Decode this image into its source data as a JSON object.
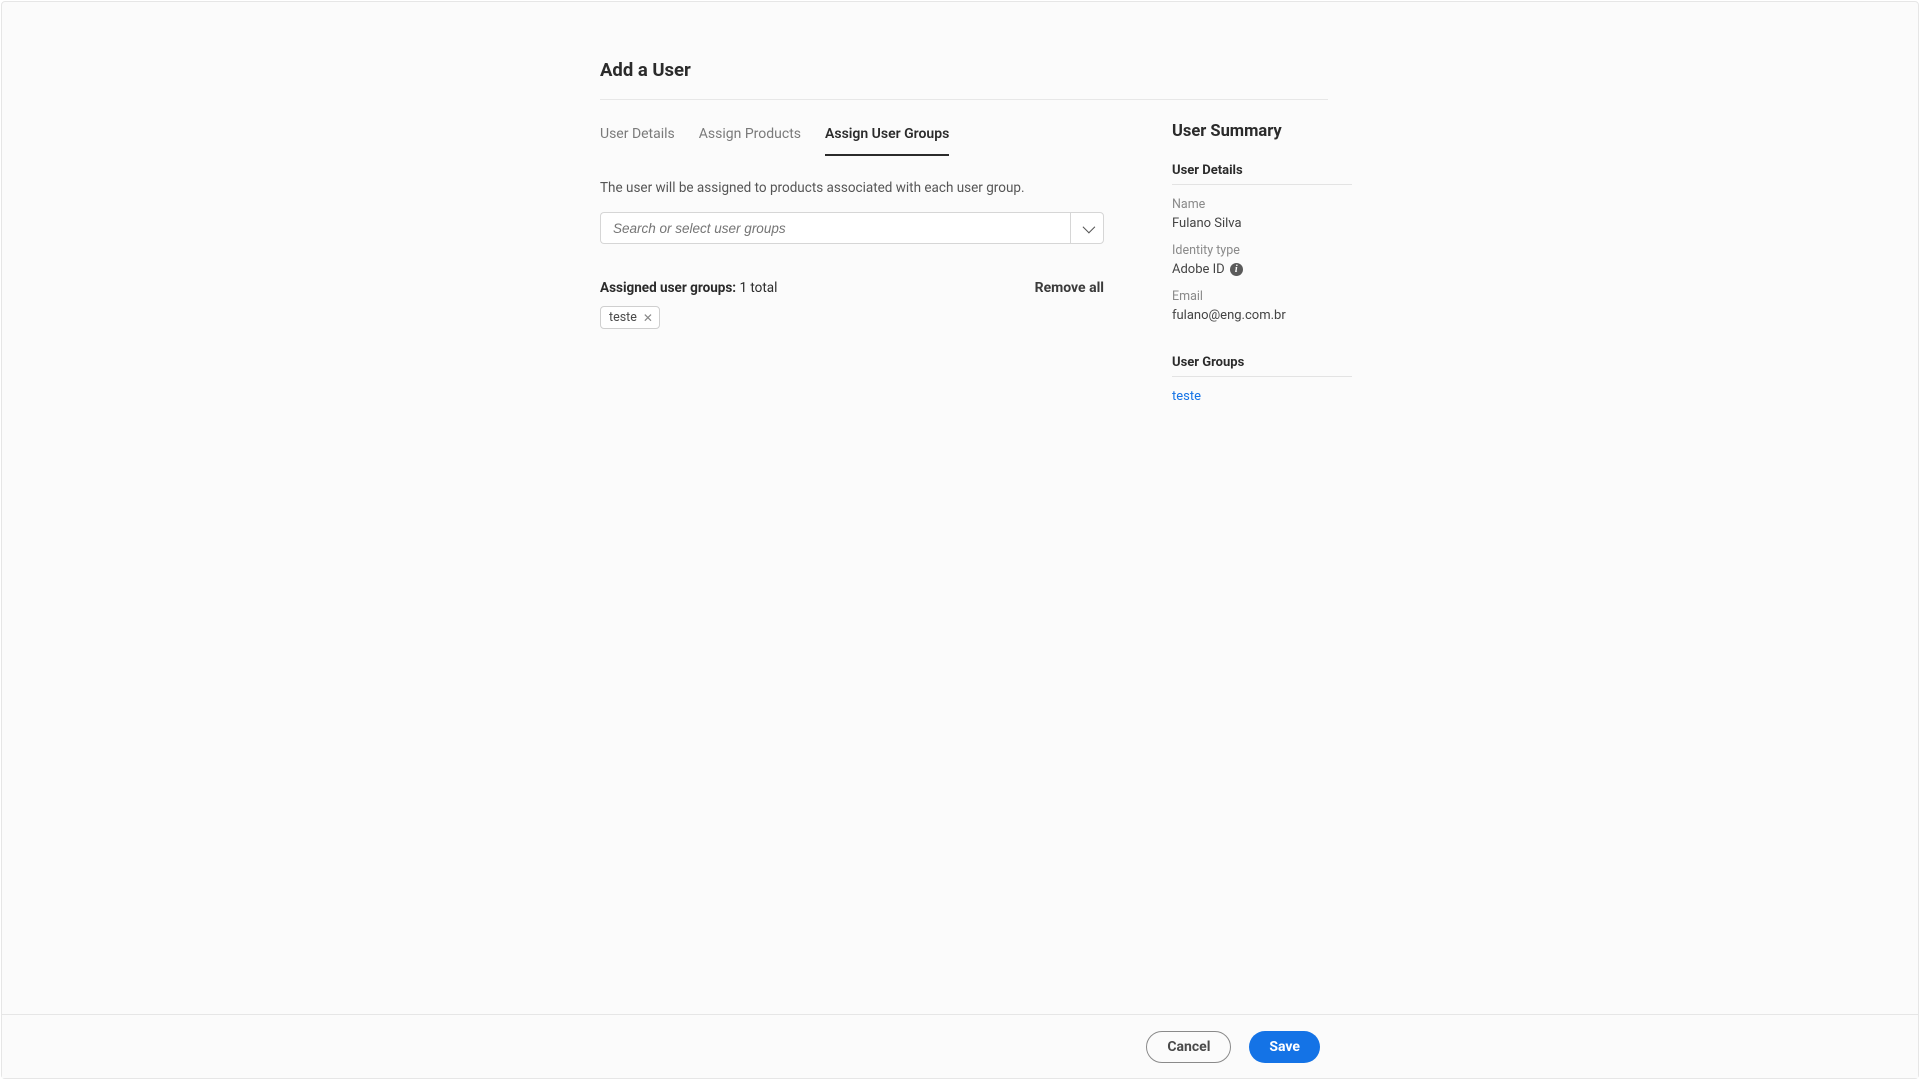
{
  "page_title": "Add a User",
  "tabs": [
    {
      "label": "User Details"
    },
    {
      "label": "Assign Products"
    },
    {
      "label": "Assign User Groups"
    }
  ],
  "active_tab_index": 2,
  "description": "The user will be assigned to products associated with each user group.",
  "search": {
    "placeholder": "Search or select user groups"
  },
  "assigned": {
    "label_prefix": "Assigned user groups:",
    "count_text": "1 total",
    "remove_all_label": "Remove all",
    "tags": [
      "teste"
    ]
  },
  "summary": {
    "title": "User Summary",
    "details_heading": "User Details",
    "name_label": "Name",
    "name_value": "Fulano Silva",
    "identity_label": "Identity type",
    "identity_value": "Adobe ID",
    "email_label": "Email",
    "email_value": "fulano@eng.com.br",
    "groups_heading": "User Groups",
    "groups": [
      "teste"
    ]
  },
  "footer": {
    "cancel": "Cancel",
    "save": "Save"
  }
}
